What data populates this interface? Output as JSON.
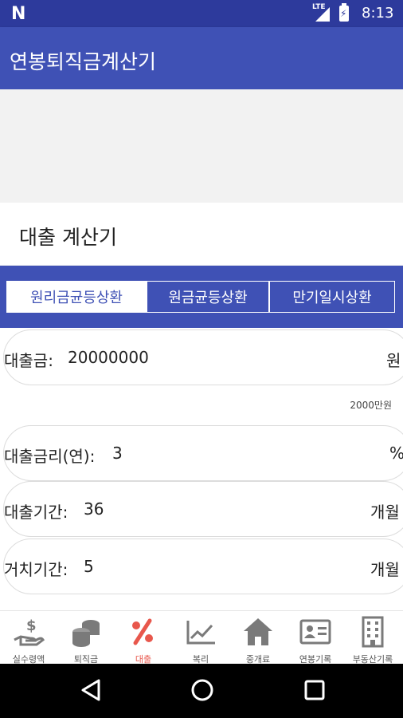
{
  "status_bar": {
    "network": "LTE",
    "time": "8:13"
  },
  "app_bar": {
    "title": "연봉퇴직금계산기"
  },
  "section": {
    "title": "대출 계산기"
  },
  "tabs": [
    {
      "label": "원리금균등상환",
      "selected": true
    },
    {
      "label": "원금균등상환",
      "selected": false
    },
    {
      "label": "만기일시상환",
      "selected": false
    }
  ],
  "form": {
    "loan_amount": {
      "label": "대출금:",
      "value": "20000000",
      "unit": "원",
      "hint": "2000만원"
    },
    "interest_rate": {
      "label": "대출금리(연):",
      "value": "3",
      "unit": "%"
    },
    "loan_period": {
      "label": "대출기간:",
      "value": "36",
      "unit": "개월"
    },
    "grace_period": {
      "label": "거치기간:",
      "value": "5",
      "unit": "개월"
    }
  },
  "bottom_nav": [
    {
      "label": "실수령액",
      "icon": "money-hand-icon",
      "active": false
    },
    {
      "label": "퇴직금",
      "icon": "coins-icon",
      "active": false
    },
    {
      "label": "대출",
      "icon": "percent-icon",
      "active": true
    },
    {
      "label": "복리",
      "icon": "trend-chart-icon",
      "active": false
    },
    {
      "label": "중개료",
      "icon": "house-icon",
      "active": false
    },
    {
      "label": "연봉기록",
      "icon": "id-card-icon",
      "active": false
    },
    {
      "label": "부동산기록",
      "icon": "building-icon",
      "active": false
    }
  ],
  "colors": {
    "primary": "#3f51b5",
    "primary_dark": "#2d3a9c",
    "active_nav": "#e8574c",
    "icon_gray": "#7a7a7a"
  }
}
